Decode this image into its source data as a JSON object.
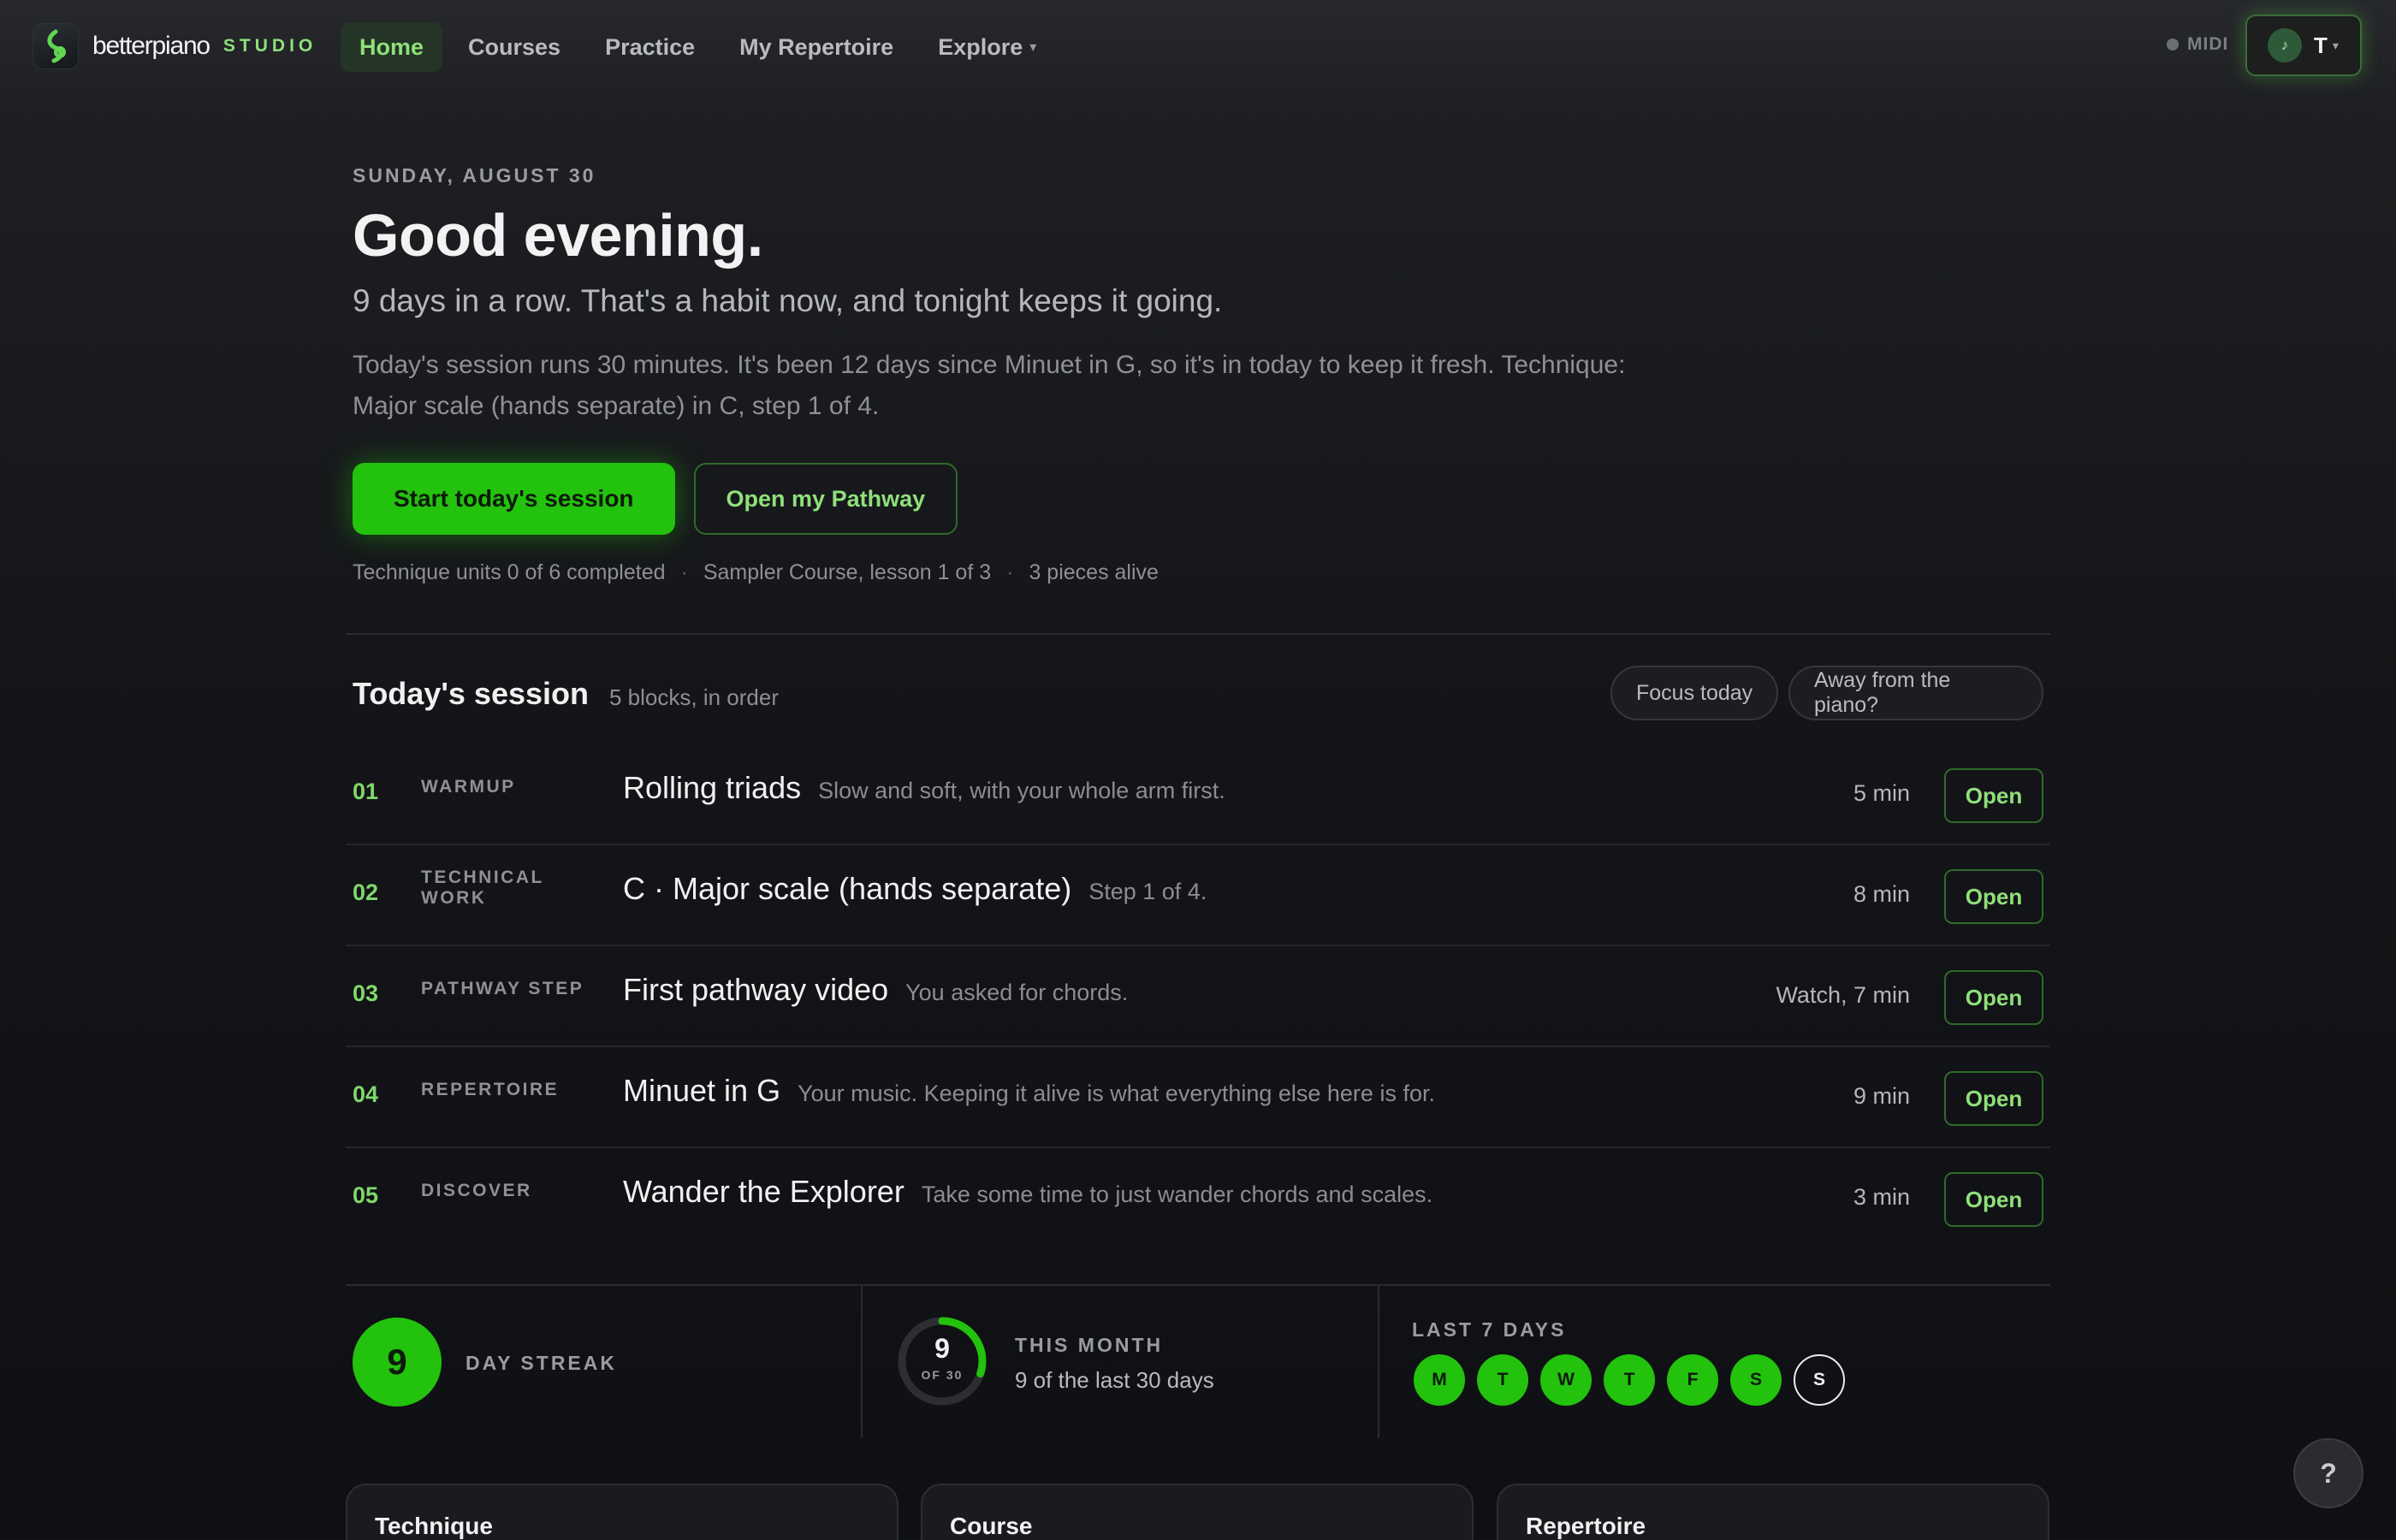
{
  "brand": {
    "word": "betterpiano",
    "studio": "STUDIO"
  },
  "nav": {
    "items": [
      {
        "label": "Home",
        "active": true
      },
      {
        "label": "Courses"
      },
      {
        "label": "Practice"
      },
      {
        "label": "My Repertoire"
      },
      {
        "label": "Explore"
      }
    ],
    "caret": "▾",
    "midi": "MIDI",
    "user_initial": "T",
    "user_avatar_glyph": "♪"
  },
  "hero": {
    "date": "SUNDAY, AUGUST 30",
    "greeting": "Good evening.",
    "subtitle": "9 days in a row. That's a habit now, and tonight keeps it going.",
    "description": "Today's session runs 30 minutes. It's been 12 days since Minuet in G, so it's in today to keep it fresh. Technique: Major scale (hands separate) in C, step 1 of 4.",
    "primary_button": "Start today's session",
    "secondary_button": "Open my Pathway",
    "meta": [
      "Technique units 0 of 6 completed",
      "Sampler Course, lesson 1 of 3",
      "3 pieces alive"
    ],
    "meta_separator": "·"
  },
  "session": {
    "title": "Today's session",
    "subtitle": "5 blocks, in order",
    "focus_pill": "Focus today",
    "away_pill": "Away from the piano?",
    "rows": [
      {
        "num": "01",
        "kind": "WARMUP",
        "title": "Rolling triads",
        "note": "Slow and soft, with your whole arm first.",
        "duration": "5 min",
        "action": "Open"
      },
      {
        "num": "02",
        "kind": "TECHNICAL WORK",
        "title": "C · Major scale (hands separate)",
        "note": "Step 1 of 4.",
        "duration": "8 min",
        "action": "Open"
      },
      {
        "num": "03",
        "kind": "PATHWAY STEP",
        "title": "First pathway video",
        "note": "You asked for chords.",
        "duration": "Watch, 7 min",
        "action": "Open"
      },
      {
        "num": "04",
        "kind": "REPERTOIRE",
        "title": "Minuet in G",
        "note": "Your music. Keeping it alive is what everything else here is for.",
        "duration": "9 min",
        "action": "Open"
      },
      {
        "num": "05",
        "kind": "DISCOVER",
        "title": "Wander the Explorer",
        "note": "Take some time to just wander chords and scales.",
        "duration": "3 min",
        "action": "Open"
      }
    ]
  },
  "stats": {
    "streak": {
      "value": "9",
      "label": "DAY STREAK"
    },
    "month": {
      "value": "9",
      "of": "OF 30",
      "label": "THIS MONTH",
      "text": "9 of the last 30 days",
      "done": 9,
      "total": 30
    },
    "week": {
      "label": "LAST 7 DAYS",
      "days": [
        {
          "letter": "M",
          "done": true
        },
        {
          "letter": "T",
          "done": true
        },
        {
          "letter": "W",
          "done": true
        },
        {
          "letter": "T",
          "done": true
        },
        {
          "letter": "F",
          "done": true
        },
        {
          "letter": "S",
          "done": true
        },
        {
          "letter": "S",
          "done": false
        }
      ]
    }
  },
  "cards": [
    "Technique",
    "Course",
    "Repertoire"
  ],
  "help": "?",
  "colors": {
    "accent": "#22c20d",
    "accent_text": "#8fe07a",
    "background": "#141518"
  }
}
